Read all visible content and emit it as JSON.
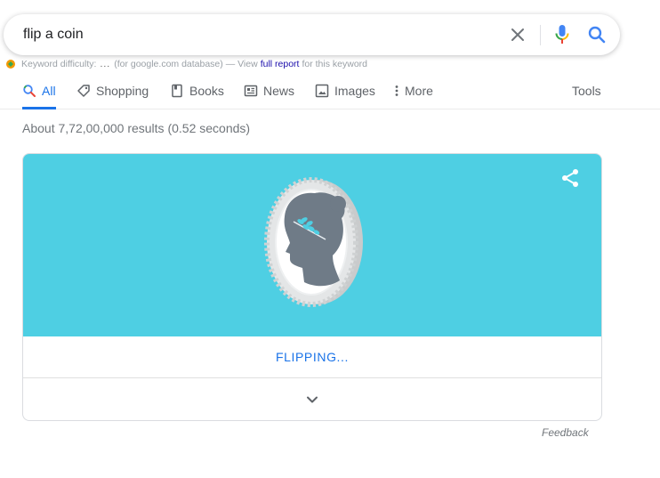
{
  "search": {
    "query": "flip a coin"
  },
  "keyword_bar": {
    "prefix": "Keyword difficulty:",
    "dots": "...",
    "middle": "(for google.com database) — View",
    "link": "full report",
    "suffix": "for this keyword"
  },
  "tabs": [
    {
      "label": "All",
      "icon": "search-icon"
    },
    {
      "label": "Shopping",
      "icon": "tag-icon"
    },
    {
      "label": "Books",
      "icon": "book-icon"
    },
    {
      "label": "News",
      "icon": "news-icon"
    },
    {
      "label": "Images",
      "icon": "image-icon"
    },
    {
      "label": "More",
      "icon": "more-vert-icon"
    }
  ],
  "tools_label": "Tools",
  "results_stats": "About 7,72,00,000 results (0.52 seconds)",
  "coin_card": {
    "status": "FLIPPING...",
    "hero_color": "#4ecfe3"
  },
  "feedback_label": "Feedback",
  "colors": {
    "accent": "#1a73e8",
    "mic_blue": "#4285f4",
    "mic_red": "#ea4335"
  }
}
